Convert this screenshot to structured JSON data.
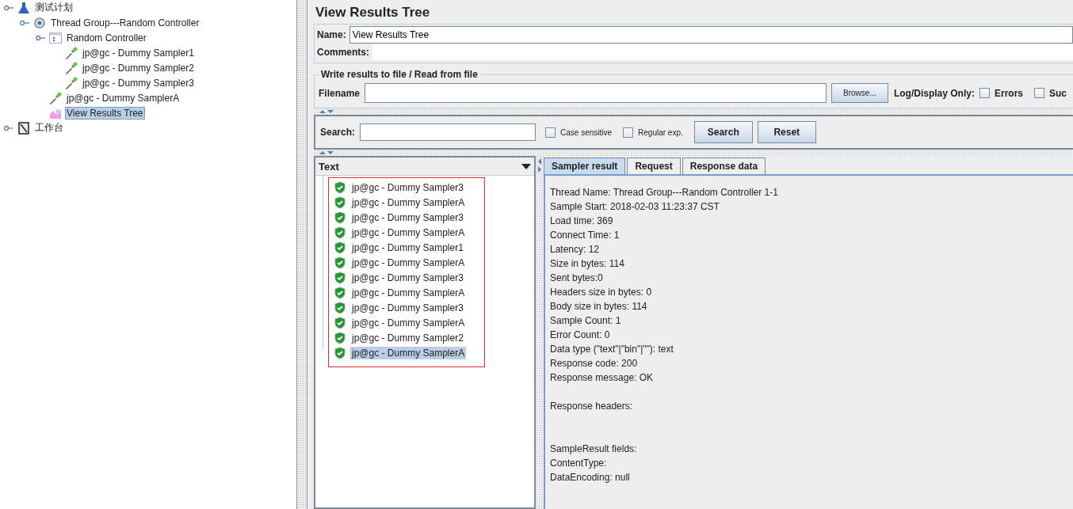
{
  "tree": [
    {
      "label": "测试计划",
      "kind": "test-plan",
      "expanded": true,
      "selected": false,
      "children": [
        {
          "label": "Thread Group---Random Controller",
          "kind": "thread-group",
          "expanded": true,
          "selected": false,
          "children": [
            {
              "label": "Random Controller",
              "kind": "controller",
              "expanded": true,
              "selected": false,
              "children": [
                {
                  "label": "jp@gc - Dummy Sampler1",
                  "kind": "sampler",
                  "selected": false
                },
                {
                  "label": "jp@gc - Dummy Sampler2",
                  "kind": "sampler",
                  "selected": false
                },
                {
                  "label": "jp@gc - Dummy Sampler3",
                  "kind": "sampler",
                  "selected": false
                }
              ]
            },
            {
              "label": "jp@gc - Dummy SamplerA",
              "kind": "sampler",
              "selected": false
            },
            {
              "label": "View Results Tree",
              "kind": "listener",
              "selected": true
            }
          ]
        }
      ]
    },
    {
      "label": "工作台",
      "kind": "workbench",
      "expanded": false,
      "selected": false
    }
  ],
  "panel": {
    "title": "View Results Tree",
    "name_label": "Name:",
    "name_value": "View Results Tree",
    "comments_label": "Comments:",
    "file_group": {
      "legend": "Write results to file / Read from file",
      "filename_label": "Filename",
      "browse_button": "Browse...",
      "log_label": "Log/Display Only:",
      "options": [
        {
          "label": "Errors",
          "checked": false
        },
        {
          "label": "Suc",
          "checked": false
        }
      ]
    },
    "search": {
      "label": "Search:",
      "options": [
        {
          "label": "Case sensitive",
          "checked": false
        },
        {
          "label": "Regular exp.",
          "checked": false
        }
      ],
      "buttons": [
        "Search",
        "Reset"
      ]
    },
    "results": {
      "column": "Text",
      "items": [
        {
          "label": "jp@gc - Dummy Sampler3",
          "selected": false
        },
        {
          "label": "jp@gc - Dummy SamplerA",
          "selected": false
        },
        {
          "label": "jp@gc - Dummy Sampler3",
          "selected": false
        },
        {
          "label": "jp@gc - Dummy SamplerA",
          "selected": false
        },
        {
          "label": "jp@gc - Dummy Sampler1",
          "selected": false
        },
        {
          "label": "jp@gc - Dummy SamplerA",
          "selected": false
        },
        {
          "label": "jp@gc - Dummy Sampler3",
          "selected": false
        },
        {
          "label": "jp@gc - Dummy SamplerA",
          "selected": false
        },
        {
          "label": "jp@gc - Dummy Sampler3",
          "selected": false
        },
        {
          "label": "jp@gc - Dummy SamplerA",
          "selected": false
        },
        {
          "label": "jp@gc - Dummy Sampler2",
          "selected": false
        },
        {
          "label": "jp@gc - Dummy SamplerA",
          "selected": true
        }
      ]
    },
    "tabs": [
      {
        "label": "Sampler result",
        "selected": true
      },
      {
        "label": "Request",
        "selected": false
      },
      {
        "label": "Response data",
        "selected": false
      }
    ],
    "detail": [
      {
        "kind": "summary",
        "lines": [
          "Thread Name: Thread Group---Random Controller 1-1",
          "Sample Start: 2018-02-03 11:23:37 CST",
          "Load time: 369",
          "Connect Time: 1",
          "Latency: 12",
          "Size in bytes: 114",
          "Sent bytes:0",
          "Headers size in bytes: 0",
          "Body size in bytes: 114",
          "Sample Count: 1",
          "Error Count: 0",
          "Data type (\"text\"|\"bin\"|\"\"): text",
          "Response code: 200",
          "Response message: OK"
        ]
      },
      {
        "kind": "headers",
        "lines": [
          "Response headers:"
        ]
      },
      {
        "kind": "fields",
        "lines": [
          "SampleResult fields:",
          "ContentType:",
          "DataEncoding: null"
        ]
      }
    ]
  }
}
